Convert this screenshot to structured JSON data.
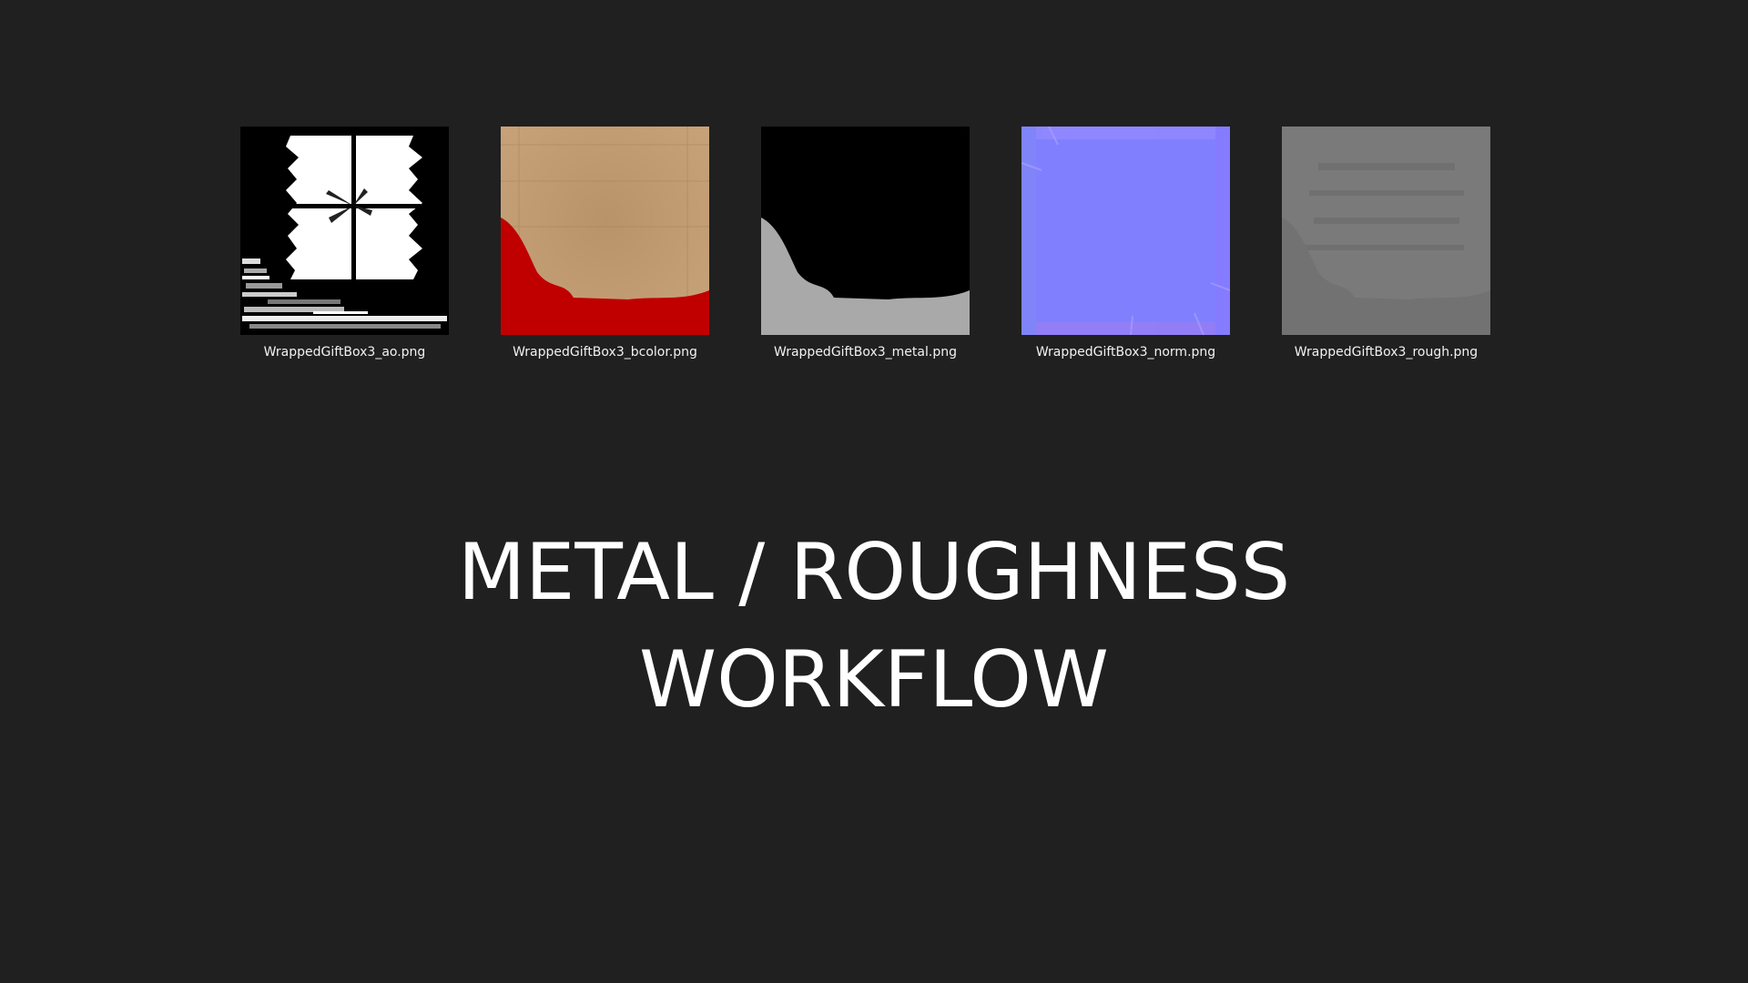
{
  "thumbnails": [
    {
      "filename": "WrappedGiftBox3_ao.png",
      "icon": "ao-map-thumbnail"
    },
    {
      "filename": "WrappedGiftBox3_bcolor.png",
      "icon": "basecolor-map-thumbnail"
    },
    {
      "filename": "WrappedGiftBox3_metal.png",
      "icon": "metal-map-thumbnail"
    },
    {
      "filename": "WrappedGiftBox3_norm.png",
      "icon": "normal-map-thumbnail"
    },
    {
      "filename": "WrappedGiftBox3_rough.png",
      "icon": "roughness-map-thumbnail"
    }
  ],
  "heading": {
    "line1": "METAL / ROUGHNESS",
    "line2": "WORKFLOW"
  },
  "colors": {
    "background": "#202020",
    "text": "#ffffff",
    "ribbon_red": "#c00000",
    "paper_tan": "#b8936a",
    "normal_blue": "#8080ff",
    "rough_gray": "#7a7a7a"
  }
}
